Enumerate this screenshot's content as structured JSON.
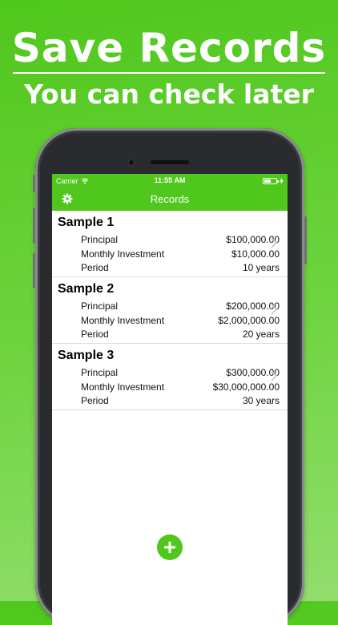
{
  "promo": {
    "title": "Save Records",
    "subtitle": "You can check later"
  },
  "statusbar": {
    "carrier": "Carrier",
    "time": "11:55 AM",
    "battery_level": 0.55
  },
  "navbar": {
    "title": "Records",
    "settings_icon": "gear-icon"
  },
  "records": [
    {
      "name": "Sample 1",
      "rows": [
        {
          "label": "Principal",
          "value": "$100,000.00"
        },
        {
          "label": "Monthly Investment",
          "value": "$10,000.00"
        },
        {
          "label": "Period",
          "value": "10 years"
        }
      ]
    },
    {
      "name": "Sample 2",
      "rows": [
        {
          "label": "Principal",
          "value": "$200,000.00"
        },
        {
          "label": "Monthly Investment",
          "value": "$2,000,000.00"
        },
        {
          "label": "Period",
          "value": "20 years"
        }
      ]
    },
    {
      "name": "Sample 3",
      "rows": [
        {
          "label": "Principal",
          "value": "$300,000.00"
        },
        {
          "label": "Monthly Investment",
          "value": "$30,000,000.00"
        },
        {
          "label": "Period",
          "value": "30 years"
        }
      ]
    }
  ],
  "colors": {
    "accent": "#4fc71c",
    "background_gradient_end": "#93dd6e"
  },
  "add_button_icon": "plus-icon"
}
